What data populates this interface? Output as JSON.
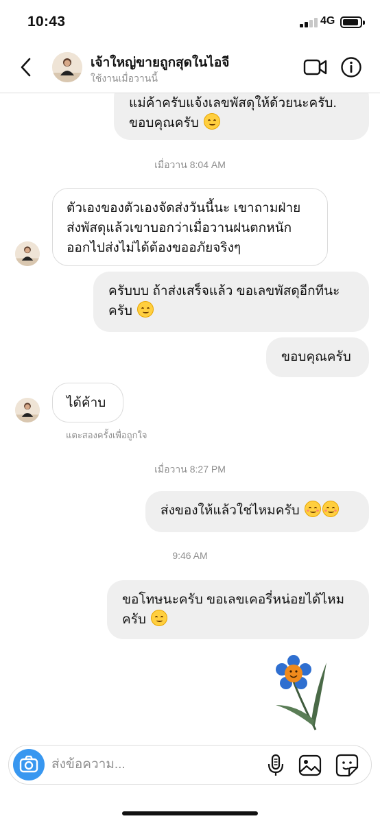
{
  "status_bar": {
    "time": "10:43",
    "network": "4G"
  },
  "header": {
    "contact_name": "เจ้าใหญ่ขายถูกสุดในไอจี",
    "activity_status": "ใช้งานเมื่อวานนี้"
  },
  "messages": [
    {
      "side": "out",
      "lines": [
        "แม่ค้าครับแจ้งเลขพัสดุให้ด้วยนะครับ.",
        "ขอบคุณครับ"
      ],
      "emoji": "smiling-face"
    },
    {
      "type": "timestamp",
      "text": "เมื่อวาน 8:04 AM"
    },
    {
      "side": "in",
      "lines": [
        "ตัวเองของตัวเองจัดส่งวันนี้นะ เขาถามฝ่าย",
        "ส่งพัสดุแล้วเขาบอกว่าเมื่อวานฝนตกหนัก",
        "ออกไปส่งไม่ได้ต้องขออภัยจริงๆ"
      ]
    },
    {
      "side": "out",
      "lines": [
        "ครับบบ ถ้าส่งเสร็จแล้ว ขอเลขพัสดุอีกทีนะ",
        "ครับ"
      ],
      "emoji": "smiling-face"
    },
    {
      "side": "out",
      "lines": [
        "ขอบคุณครับ"
      ]
    },
    {
      "side": "in",
      "lines": [
        "ได้ค้าบ"
      ]
    },
    {
      "type": "hint",
      "text": "แตะสองครั้งเพื่อถูกใจ"
    },
    {
      "type": "timestamp",
      "text": "เมื่อวาน 8:27 PM"
    },
    {
      "side": "out",
      "lines": [
        "ส่งของให้แล้วใช่ไหมครับ"
      ],
      "emoji": "smiling-face-with-smiling-eyes"
    },
    {
      "type": "timestamp",
      "text": "9:46 AM"
    },
    {
      "side": "out",
      "lines": [
        "ขอโทษนะครับ ขอเลขเคอรี่หน่อยได้ไหม",
        "ครับ"
      ],
      "emoji": "smiling-face"
    },
    {
      "side": "out",
      "type": "sticker",
      "icon": "flower-sticker"
    }
  ],
  "composer": {
    "placeholder": "ส่งข้อความ..."
  },
  "icons": {
    "back": "chevron-left-icon",
    "video": "video-camera-icon",
    "info": "info-icon",
    "camera": "camera-icon",
    "mic": "microphone-icon",
    "gallery": "image-icon",
    "sticker": "sticker-icon"
  },
  "colors": {
    "accent": "#3897f0",
    "outgoing_bubble": "#efefef",
    "muted_text": "#8e8e8e"
  }
}
